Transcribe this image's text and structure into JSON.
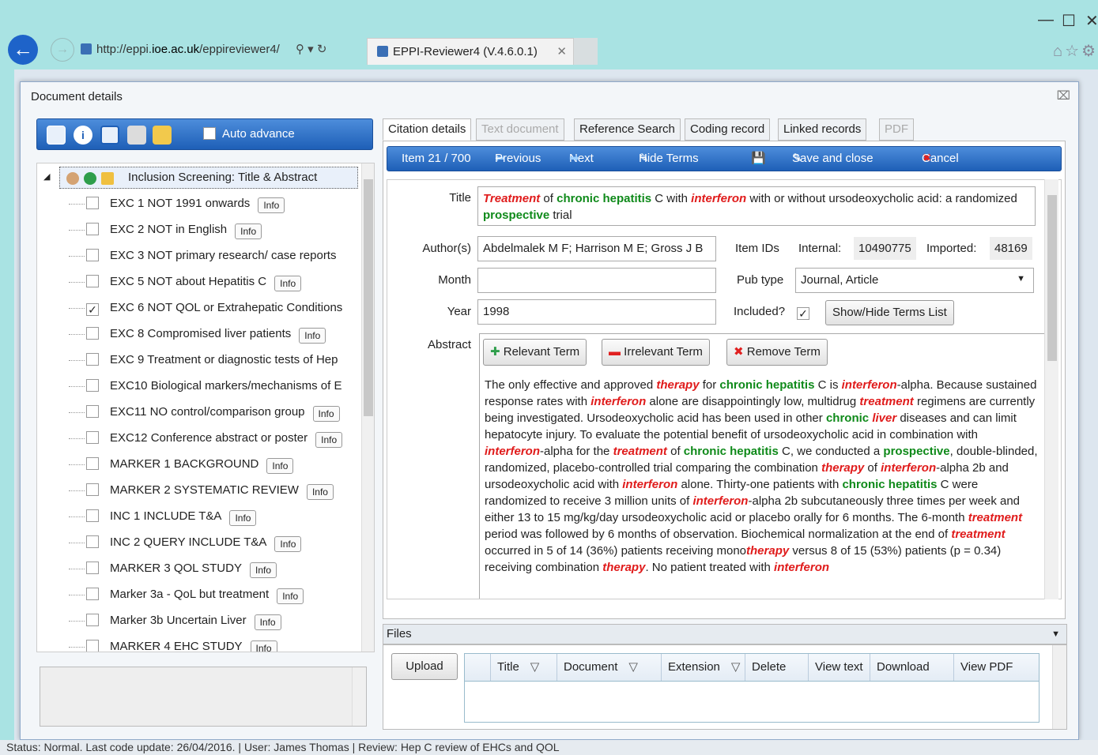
{
  "browser": {
    "url_prefix": "http://eppi.",
    "url_domain": "ioe.ac.uk",
    "url_suffix": "/eppireviewer4/",
    "tab_title": "EPPI-Reviewer4 (V.4.6.0.1)"
  },
  "dialog": {
    "title": "Document details"
  },
  "left": {
    "auto_advance": "Auto advance",
    "root_label": "Inclusion Screening: Title & Abstract",
    "info_label": "Info",
    "items": [
      {
        "label": "EXC 1 NOT 1991 onwards",
        "checked": false,
        "info": true
      },
      {
        "label": "EXC 2 NOT in English",
        "checked": false,
        "info": true
      },
      {
        "label": "EXC 3 NOT primary research/ case reports",
        "checked": false,
        "info": false
      },
      {
        "label": "EXC 5 NOT about Hepatitis C",
        "checked": false,
        "info": true
      },
      {
        "label": "EXC 6 NOT QOL or Extrahepatic Conditions",
        "checked": true,
        "info": false
      },
      {
        "label": "EXC 8 Compromised liver patients",
        "checked": false,
        "info": true
      },
      {
        "label": "EXC 9 Treatment or diagnostic tests of Hep",
        "checked": false,
        "info": false
      },
      {
        "label": "EXC10 Biological markers/mechanisms of E",
        "checked": false,
        "info": false
      },
      {
        "label": "EXC11 NO control/comparison group",
        "checked": false,
        "info": true
      },
      {
        "label": "EXC12 Conference abstract or poster",
        "checked": false,
        "info": true
      },
      {
        "label": "MARKER 1 BACKGROUND",
        "checked": false,
        "info": true
      },
      {
        "label": "MARKER 2 SYSTEMATIC REVIEW",
        "checked": false,
        "info": true
      },
      {
        "label": "INC 1 INCLUDE T&A",
        "checked": false,
        "info": true
      },
      {
        "label": "INC 2 QUERY INCLUDE T&A",
        "checked": false,
        "info": true
      },
      {
        "label": "MARKER 3 QOL STUDY",
        "checked": false,
        "info": true
      },
      {
        "label": "Marker 3a - QoL but treatment",
        "checked": false,
        "info": true
      },
      {
        "label": "Marker 3b Uncertain Liver",
        "checked": false,
        "info": true
      },
      {
        "label": "MARKER 4 EHC STUDY",
        "checked": false,
        "info": true
      }
    ]
  },
  "tabs": [
    "Citation details",
    "Text document",
    "Reference Search",
    "Coding record",
    "Linked records",
    "PDF"
  ],
  "toolbar": {
    "item": "Item 21 / 700",
    "previous": "Previous",
    "next": "Next",
    "hide_terms": "Hide Terms",
    "save_close": "Save and close",
    "cancel": "Cancel"
  },
  "citation": {
    "title_label": "Title",
    "authors_label": "Author(s)",
    "authors": "Abdelmalek M F; Harrison M E; Gross J B",
    "month_label": "Month",
    "month": "",
    "year_label": "Year",
    "year": "1998",
    "item_ids_label": "Item IDs",
    "internal_label": "Internal:",
    "internal": "10490775",
    "imported_label": "Imported:",
    "imported": "48169",
    "pub_type_label": "Pub type",
    "pub_type": "Journal, Article",
    "included_label": "Included?",
    "show_hide_terms": "Show/Hide Terms List",
    "abstract_label": "Abstract",
    "relevant_term": "Relevant Term",
    "irrelevant_term": "Irrelevant Term",
    "remove_term": "Remove Term"
  },
  "title_segments": [
    {
      "t": "Treatment",
      "s": "red"
    },
    {
      "t": " of ",
      "s": ""
    },
    {
      "t": "chronic hepatitis",
      "s": "green"
    },
    {
      "t": " C with ",
      "s": ""
    },
    {
      "t": "interferon",
      "s": "red"
    },
    {
      "t": " with or without ursodeoxycholic acid: a randomized ",
      "s": ""
    },
    {
      "t": "prospective",
      "s": "green"
    },
    {
      "t": " trial",
      "s": ""
    }
  ],
  "abstract_segments": [
    {
      "t": "The only effective and approved ",
      "s": ""
    },
    {
      "t": "therapy",
      "s": "red"
    },
    {
      "t": " for ",
      "s": ""
    },
    {
      "t": "chronic hepatitis",
      "s": "green"
    },
    {
      "t": " C is ",
      "s": ""
    },
    {
      "t": "interferon",
      "s": "red"
    },
    {
      "t": "-alpha. Because sustained response rates with ",
      "s": ""
    },
    {
      "t": "interferon",
      "s": "red"
    },
    {
      "t": " alone are disappointingly low, multidrug ",
      "s": ""
    },
    {
      "t": "treatment",
      "s": "red"
    },
    {
      "t": " regimens are currently being investigated. Ursodeoxycholic acid has been used in other ",
      "s": ""
    },
    {
      "t": "chronic",
      "s": "green"
    },
    {
      "t": " ",
      "s": ""
    },
    {
      "t": "liver",
      "s": "red"
    },
    {
      "t": " diseases and can limit hepatocyte injury. To evaluate the potential benefit of ursodeoxycholic acid in combination with ",
      "s": ""
    },
    {
      "t": "interferon",
      "s": "red"
    },
    {
      "t": "-alpha for the ",
      "s": ""
    },
    {
      "t": "treatment",
      "s": "red"
    },
    {
      "t": " of ",
      "s": ""
    },
    {
      "t": "chronic hepatitis",
      "s": "green"
    },
    {
      "t": " C, we conducted a ",
      "s": ""
    },
    {
      "t": "prospective",
      "s": "green"
    },
    {
      "t": ", double-blinded, randomized, placebo-controlled trial comparing the combination ",
      "s": ""
    },
    {
      "t": "therapy",
      "s": "red"
    },
    {
      "t": " of ",
      "s": ""
    },
    {
      "t": "interferon",
      "s": "red"
    },
    {
      "t": "-alpha 2b and ursodeoxycholic acid with ",
      "s": ""
    },
    {
      "t": "interferon",
      "s": "red"
    },
    {
      "t": " alone. Thirty-one patients with ",
      "s": ""
    },
    {
      "t": "chronic hepatitis",
      "s": "green"
    },
    {
      "t": " C were randomized to receive 3 million units of ",
      "s": ""
    },
    {
      "t": "interferon",
      "s": "red"
    },
    {
      "t": "-alpha 2b subcutaneously three times per week and either 13 to 15 mg/kg/day ursodeoxycholic acid or placebo orally for 6 months. The 6-month ",
      "s": ""
    },
    {
      "t": "treatment",
      "s": "red"
    },
    {
      "t": " period was followed by 6 months of observation. Biochemical normalization at the end of ",
      "s": ""
    },
    {
      "t": "treatment",
      "s": "red"
    },
    {
      "t": " occurred in 5 of 14 (36%) patients receiving mono",
      "s": ""
    },
    {
      "t": "therapy",
      "s": "red"
    },
    {
      "t": " versus 8 of 15 (53%) patients (p = 0.34) receiving combination ",
      "s": ""
    },
    {
      "t": "therapy",
      "s": "red"
    },
    {
      "t": ". No patient treated with ",
      "s": ""
    },
    {
      "t": "interferon",
      "s": "red"
    }
  ],
  "files": {
    "header": "Files",
    "upload": "Upload",
    "columns": [
      "Title",
      "Document",
      "Extension",
      "Delete",
      "View text",
      "Download",
      "View PDF"
    ]
  },
  "status": "Status: Normal. Last code update: 26/04/2016. | User: James Thomas | Review: Hep C review of EHCs and QOL"
}
